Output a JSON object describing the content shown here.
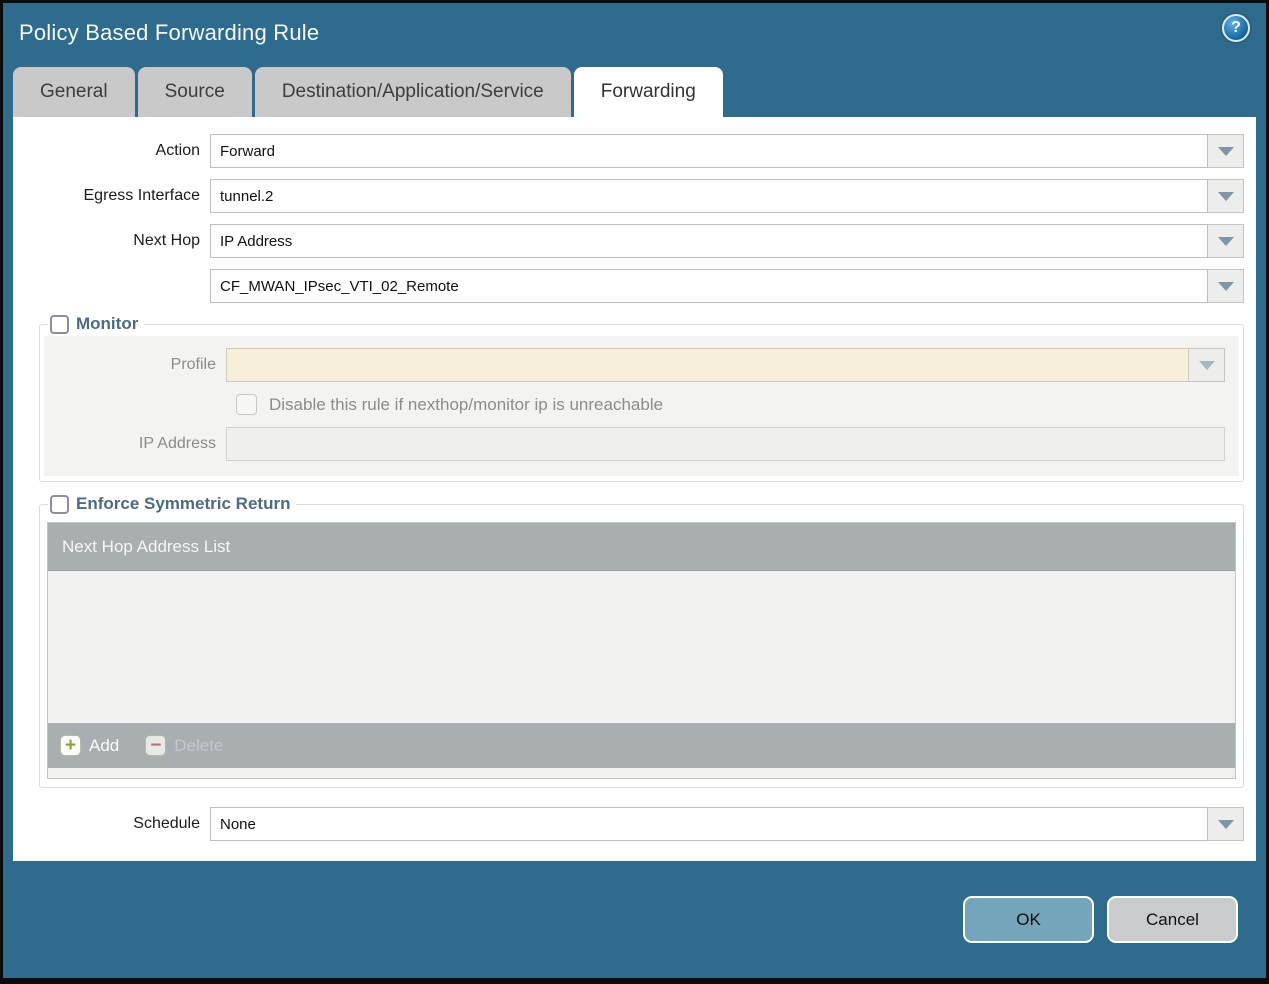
{
  "window": {
    "title": "Policy Based Forwarding Rule"
  },
  "icons": {
    "help": "?",
    "add": "+",
    "delete": "−"
  },
  "tabs": [
    {
      "label": "General",
      "active": false
    },
    {
      "label": "Source",
      "active": false
    },
    {
      "label": "Destination/Application/Service",
      "active": false
    },
    {
      "label": "Forwarding",
      "active": true
    }
  ],
  "form": {
    "action_label": "Action",
    "action_value": "Forward",
    "egress_label": "Egress Interface",
    "egress_value": "tunnel.2",
    "next_hop_label": "Next Hop",
    "next_hop_value": "IP Address",
    "next_hop_address_value": "CF_MWAN_IPsec_VTI_02_Remote",
    "schedule_label": "Schedule",
    "schedule_value": "None"
  },
  "monitor": {
    "legend": "Monitor",
    "checked": false,
    "profile_label": "Profile",
    "profile_value": "",
    "disable_checkbox_label": "Disable this rule if nexthop/monitor ip is unreachable",
    "disable_checked": false,
    "ip_address_label": "IP Address",
    "ip_address_value": ""
  },
  "enforce_symmetric_return": {
    "legend": "Enforce Symmetric Return",
    "checked": false,
    "table": {
      "header": "Next Hop Address List",
      "rows": []
    },
    "add_button": "Add",
    "delete_button": "Delete"
  },
  "footer": {
    "ok_button": "OK",
    "cancel_button": "Cancel"
  },
  "colors": {
    "titlebar_teal": "#2f6b8c",
    "tab_gray": "#c9c9c9",
    "section_title_blue": "#4e6b85",
    "disabled_field_cream": "#f6efdc",
    "table_bar_gray": "#a9aeb1",
    "ok_button_blue": "#74a5bb",
    "cancel_button_gray": "#c9cbcd",
    "add_icon_green": "#8ba33c",
    "delete_icon_red": "#b06a6a"
  }
}
